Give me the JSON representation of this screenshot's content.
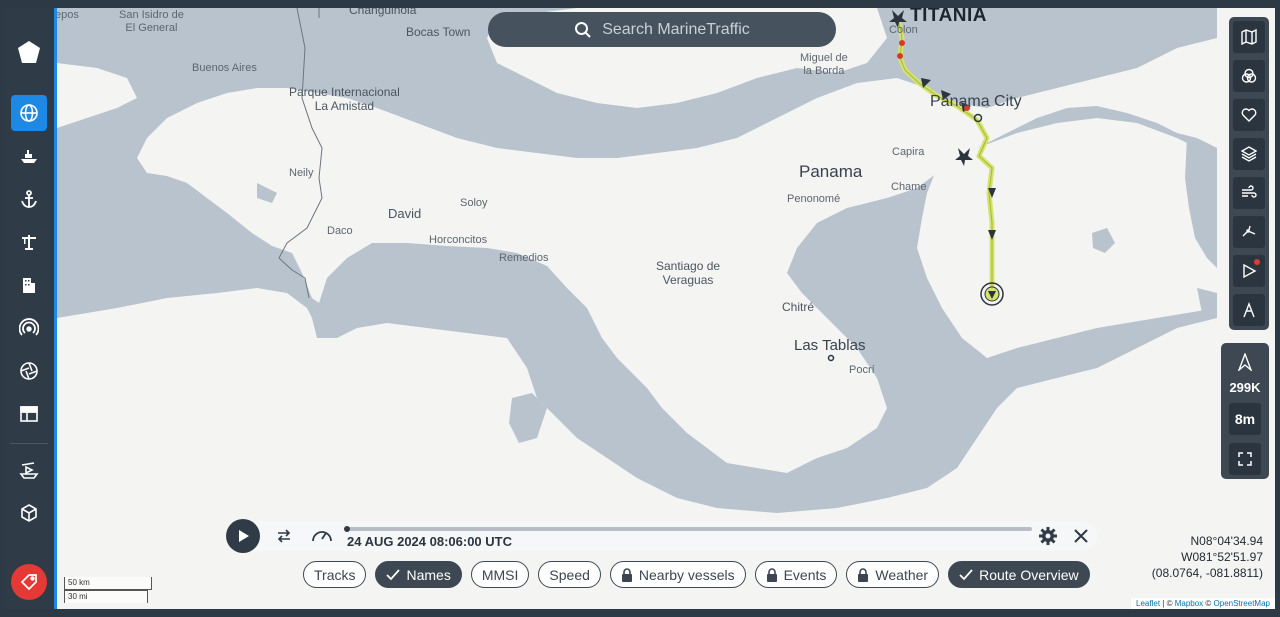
{
  "sidebar": {
    "items": [
      {
        "name": "logo-icon"
      },
      {
        "name": "globe-icon"
      },
      {
        "name": "ship-icon"
      },
      {
        "name": "anchor-icon"
      },
      {
        "name": "crane-icon"
      },
      {
        "name": "building-icon"
      },
      {
        "name": "radio-signal-icon"
      },
      {
        "name": "aperture-icon"
      },
      {
        "name": "table-icon"
      },
      {
        "name": "ship-route-icon"
      },
      {
        "name": "cube-icon"
      },
      {
        "name": "tag-icon"
      }
    ],
    "accent": "#1e88e5",
    "tag_color": "#e53935"
  },
  "search": {
    "placeholder": "Search MarineTraffic"
  },
  "map": {
    "vessel_name": "TITANIA",
    "labels": {
      "changuinola": "Changuinola",
      "bocas_town": "Bocas Town",
      "san_isidro": "San Isidro de\nEl General",
      "buenos_aires": "Buenos Aires",
      "parque": "Parque Internacional\nLa Amistad",
      "miguel": "Miguel de\nla Borda",
      "colon": "Colon",
      "panama_city": "Panama City",
      "capira": "Capira",
      "chame": "Chame",
      "panama": "Panama",
      "penonome": "Penonomé",
      "neily": "Neily",
      "david": "David",
      "soloy": "Soloy",
      "daco": "Daco",
      "horconcitos": "Horconcitos",
      "remedios": "Remedios",
      "santiago": "Santiago de\nVeraguas",
      "chitre": "Chitré",
      "las_tablas": "Las Tablas",
      "pocri": "Pocrí",
      "epos": "epos"
    }
  },
  "toolbar": {
    "buttons": [
      "map-icon",
      "filter-icon",
      "heart-icon",
      "layers-icon",
      "wind-icon",
      "measure-icon",
      "play-route-icon",
      "route-icon"
    ],
    "zoom_count": "299K",
    "timeframe": "8m",
    "fullscreen": "fullscreen-icon"
  },
  "playback": {
    "date": "24 AUG 2024 08:06:00 UTC",
    "progress": 0.0
  },
  "chips": [
    {
      "label": "Tracks",
      "on": false,
      "locked": false
    },
    {
      "label": "Names",
      "on": true,
      "locked": false
    },
    {
      "label": "MMSI",
      "on": false,
      "locked": false
    },
    {
      "label": "Speed",
      "on": false,
      "locked": false
    },
    {
      "label": "Nearby vessels",
      "on": false,
      "locked": true
    },
    {
      "label": "Events",
      "on": false,
      "locked": true
    },
    {
      "label": "Weather",
      "on": false,
      "locked": true
    },
    {
      "label": "Route Overview",
      "on": true,
      "locked": false
    }
  ],
  "coords": {
    "lat": "N08°04'34.94",
    "lon": "W081°52'51.97",
    "decimal": "(08.0764, -081.8811)"
  },
  "scale": {
    "km": "50 km",
    "mi": "30 mi"
  },
  "attribution": {
    "leaflet": "Leaflet",
    "sep1": " | © ",
    "mapbox": "Mapbox",
    "sep2": " © ",
    "osm": "OpenStreetMap"
  }
}
